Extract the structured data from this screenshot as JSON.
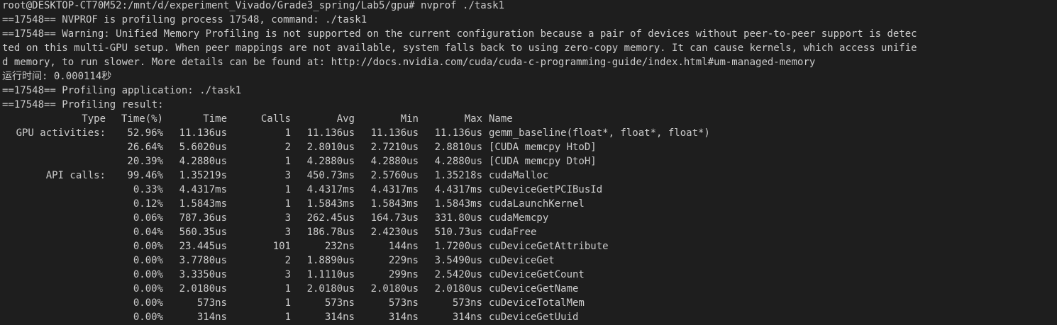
{
  "terminal": {
    "prompt_line": "root@DESKTOP-CT70M52:/mnt/d/experiment_Vivado/Grade3_spring/Lab5/gpu# nvprof ./task1",
    "lines": [
      "==17548== NVPROF is profiling process 17548, command: ./task1",
      "==17548== Warning: Unified Memory Profiling is not supported on the current configuration because a pair of devices without peer-to-peer support is detec",
      "ted on this multi-GPU setup. When peer mappings are not available, system falls back to using zero-copy memory. It can cause kernels, which access unifie",
      "d memory, to run slower. More details can be found at: http://docs.nvidia.com/cuda/cuda-c-programming-guide/index.html#um-managed-memory",
      "运行时间: 0.000114秒",
      "==17548== Profiling application: ./task1",
      "==17548== Profiling result:"
    ]
  },
  "profile": {
    "headers": {
      "type": "Type",
      "time_pct": "Time(%)",
      "time": "Time",
      "calls": "Calls",
      "avg": "Avg",
      "min": "Min",
      "max": "Max",
      "name": "Name"
    },
    "rows": [
      {
        "type": "GPU activities:",
        "time_pct": "52.96%",
        "time": "11.136us",
        "calls": "1",
        "avg": "11.136us",
        "min": "11.136us",
        "max": "11.136us",
        "name": "gemm_baseline(float*, float*, float*)"
      },
      {
        "type": "",
        "time_pct": "26.64%",
        "time": "5.6020us",
        "calls": "2",
        "avg": "2.8010us",
        "min": "2.7210us",
        "max": "2.8810us",
        "name": "[CUDA memcpy HtoD]"
      },
      {
        "type": "",
        "time_pct": "20.39%",
        "time": "4.2880us",
        "calls": "1",
        "avg": "4.2880us",
        "min": "4.2880us",
        "max": "4.2880us",
        "name": "[CUDA memcpy DtoH]"
      },
      {
        "type": "API calls:",
        "time_pct": "99.46%",
        "time": "1.35219s",
        "calls": "3",
        "avg": "450.73ms",
        "min": "2.5760us",
        "max": "1.35218s",
        "name": "cudaMalloc"
      },
      {
        "type": "",
        "time_pct": "0.33%",
        "time": "4.4317ms",
        "calls": "1",
        "avg": "4.4317ms",
        "min": "4.4317ms",
        "max": "4.4317ms",
        "name": "cuDeviceGetPCIBusId"
      },
      {
        "type": "",
        "time_pct": "0.12%",
        "time": "1.5843ms",
        "calls": "1",
        "avg": "1.5843ms",
        "min": "1.5843ms",
        "max": "1.5843ms",
        "name": "cudaLaunchKernel"
      },
      {
        "type": "",
        "time_pct": "0.06%",
        "time": "787.36us",
        "calls": "3",
        "avg": "262.45us",
        "min": "164.73us",
        "max": "331.80us",
        "name": "cudaMemcpy"
      },
      {
        "type": "",
        "time_pct": "0.04%",
        "time": "560.35us",
        "calls": "3",
        "avg": "186.78us",
        "min": "2.4230us",
        "max": "510.73us",
        "name": "cudaFree"
      },
      {
        "type": "",
        "time_pct": "0.00%",
        "time": "23.445us",
        "calls": "101",
        "avg": "232ns",
        "min": "144ns",
        "max": "1.7200us",
        "name": "cuDeviceGetAttribute"
      },
      {
        "type": "",
        "time_pct": "0.00%",
        "time": "3.7780us",
        "calls": "2",
        "avg": "1.8890us",
        "min": "229ns",
        "max": "3.5490us",
        "name": "cuDeviceGet"
      },
      {
        "type": "",
        "time_pct": "0.00%",
        "time": "3.3350us",
        "calls": "3",
        "avg": "1.1110us",
        "min": "299ns",
        "max": "2.5420us",
        "name": "cuDeviceGetCount"
      },
      {
        "type": "",
        "time_pct": "0.00%",
        "time": "2.0180us",
        "calls": "1",
        "avg": "2.0180us",
        "min": "2.0180us",
        "max": "2.0180us",
        "name": "cuDeviceGetName"
      },
      {
        "type": "",
        "time_pct": "0.00%",
        "time": "573ns",
        "calls": "1",
        "avg": "573ns",
        "min": "573ns",
        "max": "573ns",
        "name": "cuDeviceTotalMem"
      },
      {
        "type": "",
        "time_pct": "0.00%",
        "time": "314ns",
        "calls": "1",
        "avg": "314ns",
        "min": "314ns",
        "max": "314ns",
        "name": "cuDeviceGetUuid"
      }
    ]
  },
  "colors": {
    "background": "#1e1e1e",
    "foreground": "#cccccc"
  }
}
